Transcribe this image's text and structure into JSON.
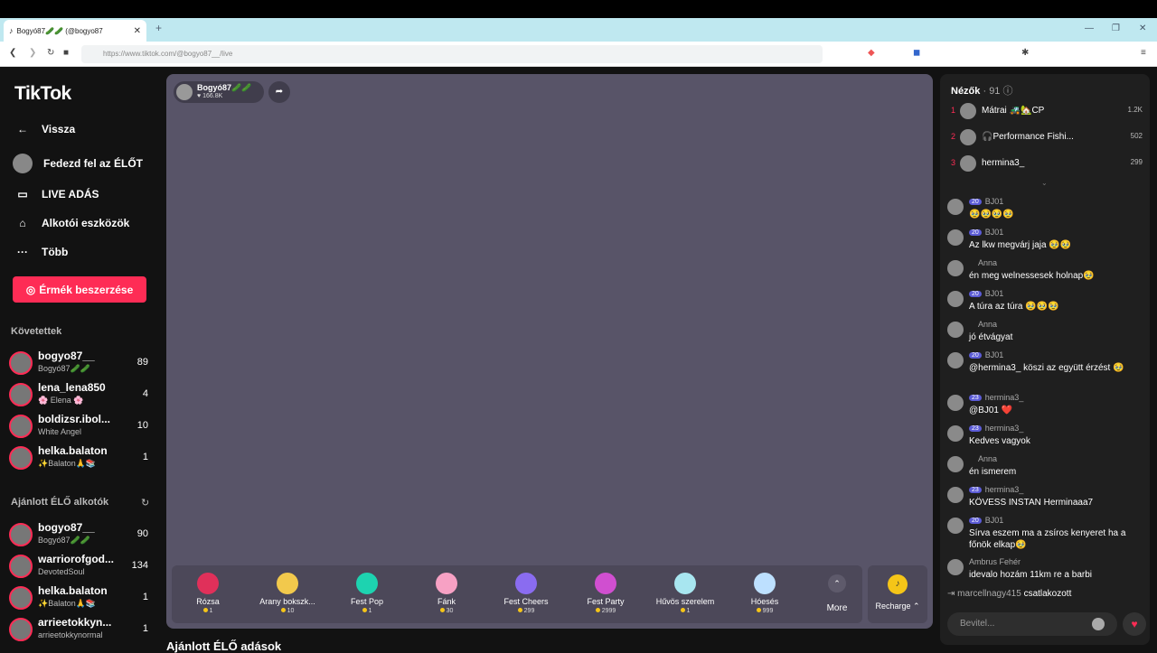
{
  "browser": {
    "tab_title": "Bogyó87🥒🥒 (@bogyo87",
    "url": "https://www.tiktok.com/@bogyo87__/live"
  },
  "sidebar": {
    "logo": "TikTok",
    "nav": [
      {
        "label": "Vissza",
        "icon": "back-arrow-icon"
      },
      {
        "label": "Fedezd fel az ÉLŐT",
        "icon": "avatar-icon"
      },
      {
        "label": "LIVE ADÁS",
        "icon": "video-camera-icon"
      },
      {
        "label": "Alkotói eszközök",
        "icon": "lightbulb-icon"
      },
      {
        "label": "Több",
        "icon": "more-dots-icon"
      }
    ],
    "coins_button": "Érmék beszerzése",
    "following_header": "Követettek",
    "following": [
      {
        "name": "bogyo87__",
        "sub": "Bogyó87🥒🥒",
        "count": "89"
      },
      {
        "name": "lena_lena850",
        "sub": "🌸 Elena 🌸",
        "count": "4"
      },
      {
        "name": "boldizsr.ibol...",
        "sub": "White Angel",
        "count": "10"
      },
      {
        "name": "helka.balaton",
        "sub": "✨Balaton🙏📚",
        "count": "1"
      }
    ],
    "recommended_header": "Ajánlott ÉLŐ alkotók",
    "recommended": [
      {
        "name": "bogyo87__",
        "sub": "Bogyó87🥒🥒",
        "count": "90"
      },
      {
        "name": "warriorofgod...",
        "sub": "DevotedSoul",
        "count": "134"
      },
      {
        "name": "helka.balaton",
        "sub": "✨Balaton🙏📚",
        "count": "1"
      },
      {
        "name": "arrieetokkyn...",
        "sub": "arrieetokkynormal",
        "count": "1"
      }
    ]
  },
  "player": {
    "host_name": "Bogyó87🥒🥒",
    "host_likes": "♥ 166.8K",
    "gifts": [
      {
        "name": "Rózsa",
        "price": "1",
        "color": "#e0305a"
      },
      {
        "name": "Arany bokszk...",
        "price": "10",
        "color": "#f2c94c"
      },
      {
        "name": "Fest Pop",
        "price": "1",
        "color": "#1dd3b0"
      },
      {
        "name": "Fánk",
        "price": "30",
        "color": "#f7a1c4"
      },
      {
        "name": "Fest Cheers",
        "price": "299",
        "color": "#8a6cf0"
      },
      {
        "name": "Fest Party",
        "price": "2999",
        "color": "#d04fd0"
      },
      {
        "name": "Hűvös szerelem",
        "price": "1",
        "color": "#a8e6f0"
      },
      {
        "name": "Hóesés",
        "price": "999",
        "color": "#bde0ff"
      }
    ],
    "more_label": "More",
    "recharge_label": "Recharge ⌃"
  },
  "recommended_live_title": "Ajánlott ÉLŐ adások",
  "chat": {
    "viewers_label": "Nézők",
    "viewers_count": "· 91",
    "top_viewers": [
      {
        "rank": "1",
        "name": "Mátrai 🚜🏡CP",
        "score": "1.2K"
      },
      {
        "rank": "2",
        "name": "🎧Performance Fishi...",
        "score": "502"
      },
      {
        "rank": "3",
        "name": "hermina3_",
        "score": "299"
      }
    ],
    "messages": [
      {
        "badge": "20",
        "badge_type": "b",
        "user": "BJ01",
        "text": "🥹🥹🥹🥹"
      },
      {
        "badge": "20",
        "badge_type": "b",
        "user": "BJ01",
        "text": "Az lkw megvárj jaja 🥹🥹"
      },
      {
        "badge": "",
        "badge_type": "g",
        "user": "Anna",
        "text": "én meg welnessesek holnap🥹"
      },
      {
        "badge": "20",
        "badge_type": "b",
        "user": "BJ01",
        "text": "A túra az túra 🥹🥹🥹"
      },
      {
        "badge": "",
        "badge_type": "g",
        "user": "Anna",
        "text": "jó étvágyat"
      },
      {
        "badge": "20",
        "badge_type": "b",
        "user": "BJ01",
        "text": "@hermina3_ köszi az együtt érzést 🥹"
      },
      {
        "badge": "23",
        "badge_type": "b",
        "user": "hermina3_",
        "text": "@BJ01 ❤️"
      },
      {
        "badge": "23",
        "badge_type": "b",
        "user": "hermina3_",
        "text": "Kedves vagyok"
      },
      {
        "badge": "",
        "badge_type": "g",
        "user": "Anna",
        "text": "én ismerem"
      },
      {
        "badge": "23",
        "badge_type": "b",
        "user": "hermina3_",
        "text": "KÖVESS INSTAN Herminaaa7"
      },
      {
        "badge": "20",
        "badge_type": "b",
        "user": "BJ01",
        "text": "Sírva eszem ma a zsíros kenyeret ha a főnök elkap🥹"
      },
      {
        "badge": "",
        "badge_type": "none",
        "user": "Ambrus Fehér",
        "text": "idevalo hozám 11km re a barbi"
      }
    ],
    "join_user": "marcellnagy415",
    "join_text": "csatlakozott",
    "input_placeholder": "Bevitel..."
  }
}
